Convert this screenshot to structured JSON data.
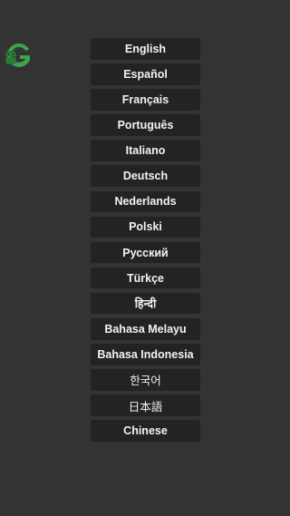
{
  "logo": {
    "icon": "android-g-logo-icon",
    "colors": {
      "green": "#3fa34d",
      "dark_green": "#2b7a35"
    }
  },
  "languages": [
    "English",
    "Español",
    "Français",
    "Português",
    "Italiano",
    "Deutsch",
    "Nederlands",
    "Polski",
    "Русский",
    "Türkçe",
    "हिन्दी",
    "Bahasa Melayu",
    "Bahasa Indonesia",
    "한국어",
    "日本語",
    "Chinese"
  ],
  "colors": {
    "background": "#333333",
    "button_bg": "#232323",
    "button_text": "#f2f2f2"
  }
}
